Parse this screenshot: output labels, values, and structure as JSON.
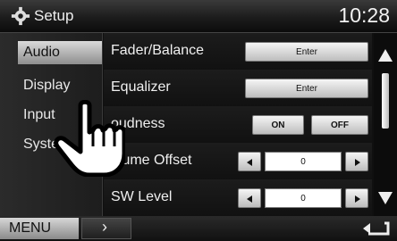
{
  "header": {
    "title": "Setup",
    "time": "10:28"
  },
  "sidebar": {
    "items": [
      {
        "label": "Audio",
        "active": true
      },
      {
        "label": "Display",
        "active": false
      },
      {
        "label": "Input",
        "active": false
      },
      {
        "label": "Syste",
        "active": false
      }
    ]
  },
  "list": {
    "rows": [
      {
        "label": "Fader/Balance",
        "button": "Enter"
      },
      {
        "label": "Equalizer",
        "button": "Enter"
      },
      {
        "label": "oudness",
        "on": "ON",
        "off": "OFF"
      },
      {
        "label": "olume Offset",
        "value": "0"
      },
      {
        "label": "SW Level",
        "value": "0"
      }
    ]
  },
  "bottom": {
    "menu": "MENU",
    "next_icon": "chevron-right-icon",
    "back_icon": "back-arrow-icon"
  },
  "icons": {
    "header": "gear-icon",
    "overlay": "pointing-hand-icon"
  }
}
